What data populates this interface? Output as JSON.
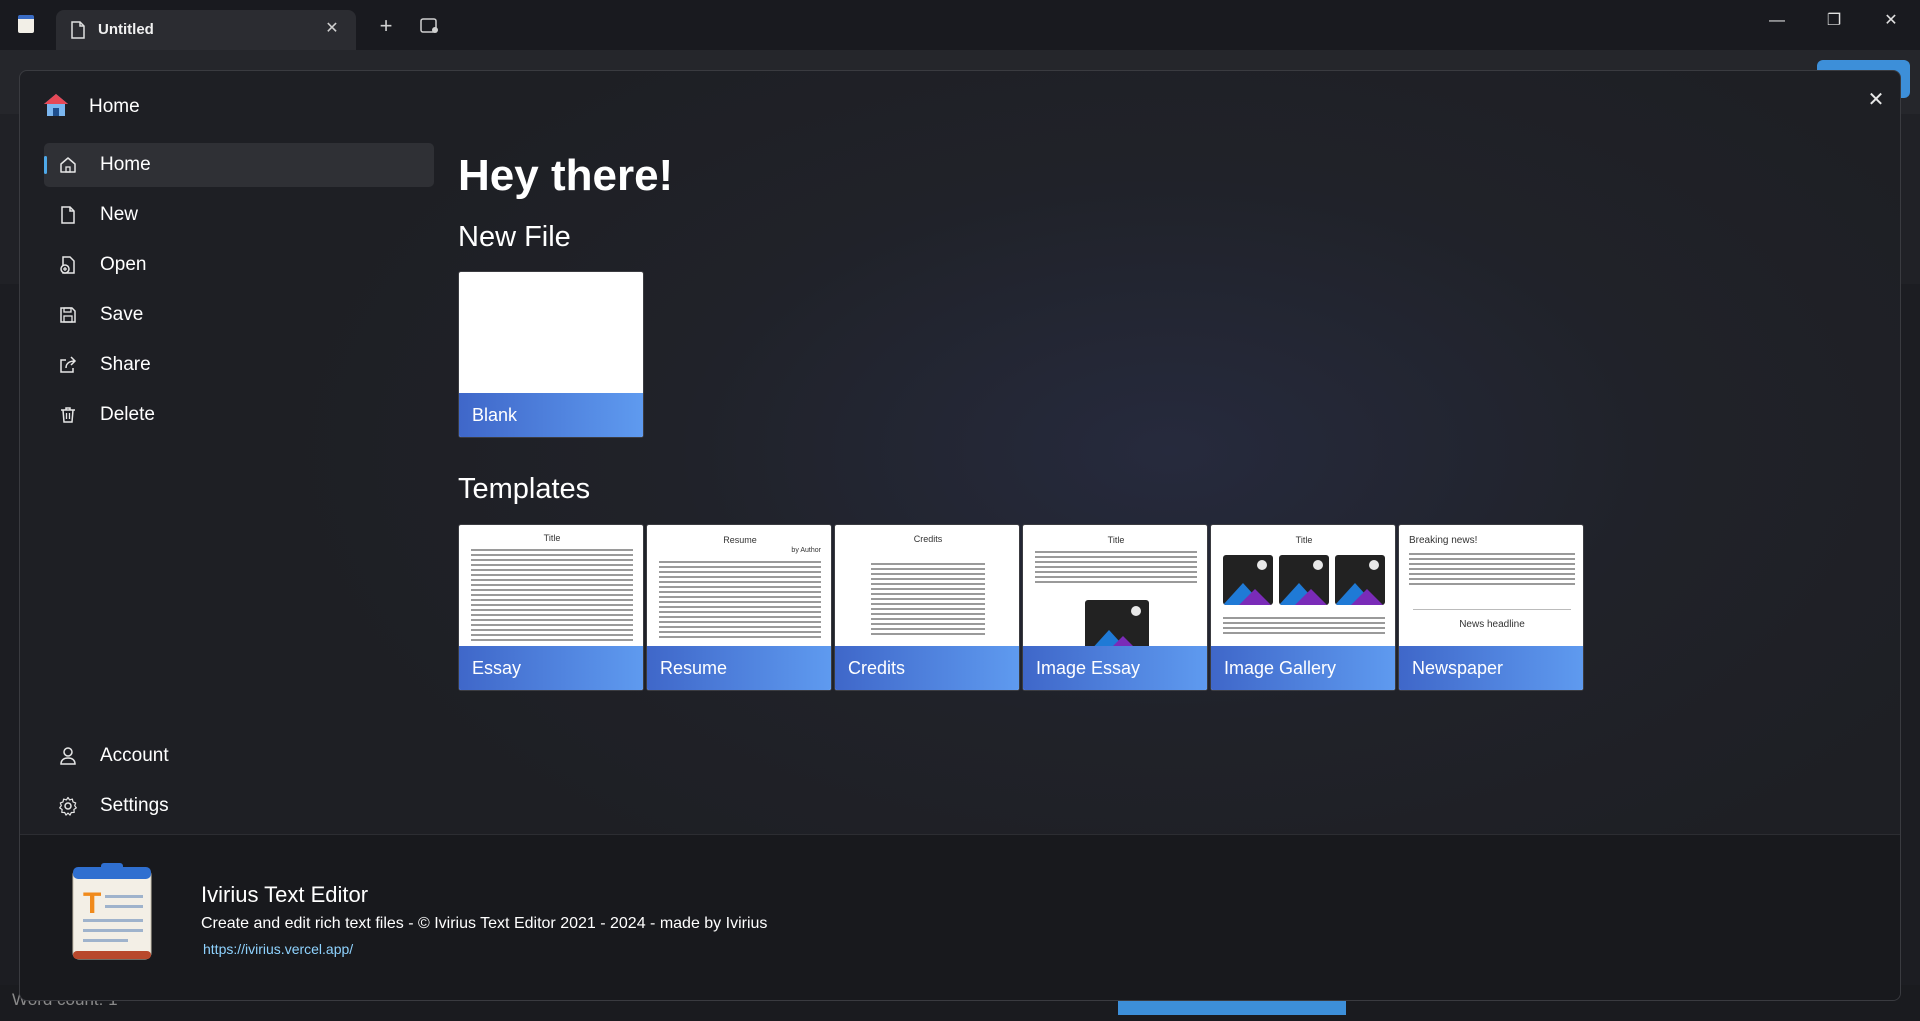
{
  "titlebar": {
    "tab_title": "Untitled",
    "new_tab_symbol": "+",
    "close_symbol": "✕",
    "min_symbol": "—",
    "max_symbol": "❐"
  },
  "background": {
    "status_text": "Word count: 1"
  },
  "dialog": {
    "header_title": "Home",
    "close_symbol": "✕",
    "nav": [
      {
        "label": "Home",
        "icon": "home-icon",
        "selected": true
      },
      {
        "label": "New",
        "icon": "new-file-icon"
      },
      {
        "label": "Open",
        "icon": "open-icon"
      },
      {
        "label": "Save",
        "icon": "save-icon"
      },
      {
        "label": "Share",
        "icon": "share-icon"
      },
      {
        "label": "Delete",
        "icon": "delete-icon"
      },
      {
        "label": "Account",
        "icon": "account-icon"
      },
      {
        "label": "Settings",
        "icon": "settings-icon"
      }
    ],
    "greeting": "Hey there!",
    "new_file_heading": "New File",
    "blank_label": "Blank",
    "templates_heading": "Templates",
    "templates": [
      {
        "label": "Essay",
        "preview_title": "Title"
      },
      {
        "label": "Resume",
        "preview_title": "Resume",
        "preview_subtitle": "by Author"
      },
      {
        "label": "Credits",
        "preview_title": "Credits"
      },
      {
        "label": "Image Essay",
        "preview_title": "Title"
      },
      {
        "label": "Image Gallery",
        "preview_title": "Title"
      },
      {
        "label": "Newspaper",
        "preview_title": "Breaking news!",
        "preview_subtitle": "News headline"
      }
    ],
    "footer": {
      "app_name": "Ivirius Text Editor",
      "description": "Create and edit rich text files - © Ivirius Text Editor 2021 - 2024 - made by Ivirius",
      "link": "https://ivirius.vercel.app/"
    }
  },
  "colors": {
    "accent": "#4ea8e8",
    "card_gradient_start": "#3f67c9",
    "card_gradient_end": "#5f9bf0",
    "link": "#8fd3ff"
  }
}
